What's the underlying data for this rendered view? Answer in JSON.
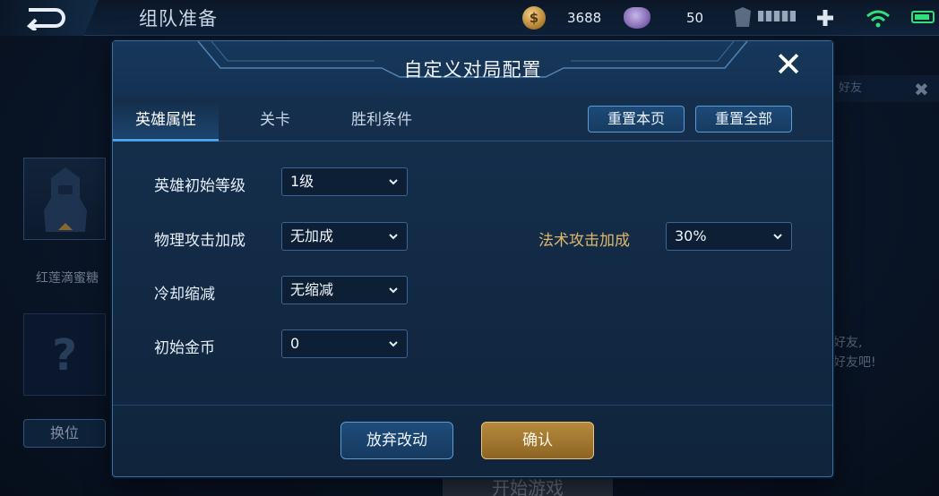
{
  "topbar": {
    "title": "组队准备",
    "gold_amount": "3688",
    "gem_amount": "50"
  },
  "background": {
    "hero_name": "红莲滴蜜糖",
    "empty_slot_mark": "?",
    "swap_label": "换位",
    "side_tab_text": "好友",
    "side_text_line1": "好友,",
    "side_text_line2": "好友吧!",
    "start_label": "开始游戏"
  },
  "modal": {
    "title": "自定义对局配置",
    "tabs": [
      {
        "label": "英雄属性",
        "active": true
      },
      {
        "label": "关卡",
        "active": false
      },
      {
        "label": "胜利条件",
        "active": false
      }
    ],
    "reset_page_label": "重置本页",
    "reset_all_label": "重置全部",
    "fields": {
      "hero_level": {
        "label": "英雄初始等级",
        "value": "1级"
      },
      "physical_attack": {
        "label": "物理攻击加成",
        "value": "无加成"
      },
      "magic_attack": {
        "label": "法术攻击加成",
        "value": "30%"
      },
      "cooldown": {
        "label": "冷却缩减",
        "value": "无缩减"
      },
      "gold": {
        "label": "初始金币",
        "value": "0"
      }
    },
    "discard_label": "放弃改动",
    "confirm_label": "确认"
  },
  "colors": {
    "accent_blue": "#4aa3ee",
    "confirm_gold": "#b58a3c",
    "magic_label": "#e0b86a",
    "wifi_green": "#2fe07a"
  },
  "icons": [
    "back-icon",
    "coin-icon",
    "gem-icon",
    "add-icon",
    "wifi-icon",
    "battery-icon",
    "close-icon",
    "chevron-down-icon",
    "hero-silhouette-icon"
  ]
}
